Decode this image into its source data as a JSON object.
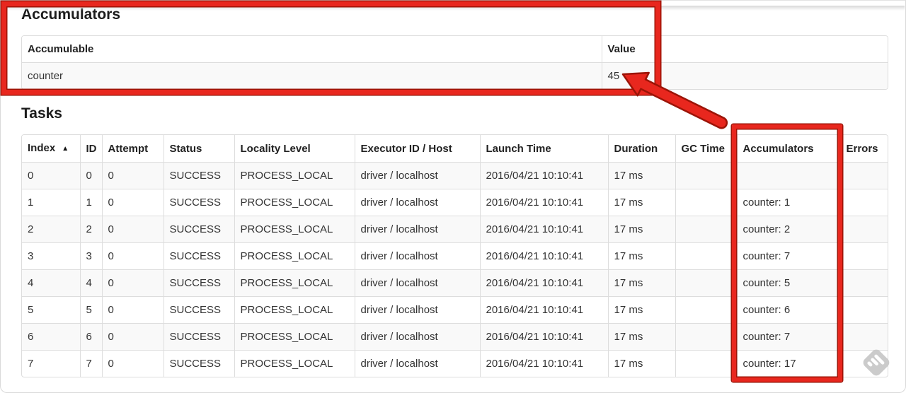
{
  "accumulators_section": {
    "title": "Accumulators",
    "table": {
      "headers": [
        "Accumulable",
        "Value"
      ],
      "rows": [
        {
          "accumulable": "counter",
          "value": "45"
        }
      ]
    }
  },
  "tasks_section": {
    "title": "Tasks",
    "table": {
      "headers": {
        "index": "Index",
        "id": "ID",
        "attempt": "Attempt",
        "status": "Status",
        "locality": "Locality Level",
        "executor": "Executor ID / Host",
        "launch": "Launch Time",
        "duration": "Duration",
        "gc": "GC Time",
        "accumulators": "Accumulators",
        "errors": "Errors"
      },
      "sort_indicator": "▲",
      "rows": [
        {
          "index": "0",
          "id": "0",
          "attempt": "0",
          "status": "SUCCESS",
          "locality": "PROCESS_LOCAL",
          "executor": "driver / localhost",
          "launch": "2016/04/21 10:10:41",
          "duration": "17 ms",
          "gc": "",
          "accumulators": "",
          "errors": ""
        },
        {
          "index": "1",
          "id": "1",
          "attempt": "0",
          "status": "SUCCESS",
          "locality": "PROCESS_LOCAL",
          "executor": "driver / localhost",
          "launch": "2016/04/21 10:10:41",
          "duration": "17 ms",
          "gc": "",
          "accumulators": "counter: 1",
          "errors": ""
        },
        {
          "index": "2",
          "id": "2",
          "attempt": "0",
          "status": "SUCCESS",
          "locality": "PROCESS_LOCAL",
          "executor": "driver / localhost",
          "launch": "2016/04/21 10:10:41",
          "duration": "17 ms",
          "gc": "",
          "accumulators": "counter: 2",
          "errors": ""
        },
        {
          "index": "3",
          "id": "3",
          "attempt": "0",
          "status": "SUCCESS",
          "locality": "PROCESS_LOCAL",
          "executor": "driver / localhost",
          "launch": "2016/04/21 10:10:41",
          "duration": "17 ms",
          "gc": "",
          "accumulators": "counter: 7",
          "errors": ""
        },
        {
          "index": "4",
          "id": "4",
          "attempt": "0",
          "status": "SUCCESS",
          "locality": "PROCESS_LOCAL",
          "executor": "driver / localhost",
          "launch": "2016/04/21 10:10:41",
          "duration": "17 ms",
          "gc": "",
          "accumulators": "counter: 5",
          "errors": ""
        },
        {
          "index": "5",
          "id": "5",
          "attempt": "0",
          "status": "SUCCESS",
          "locality": "PROCESS_LOCAL",
          "executor": "driver / localhost",
          "launch": "2016/04/21 10:10:41",
          "duration": "17 ms",
          "gc": "",
          "accumulators": "counter: 6",
          "errors": ""
        },
        {
          "index": "6",
          "id": "6",
          "attempt": "0",
          "status": "SUCCESS",
          "locality": "PROCESS_LOCAL",
          "executor": "driver / localhost",
          "launch": "2016/04/21 10:10:41",
          "duration": "17 ms",
          "gc": "",
          "accumulators": "counter: 7",
          "errors": ""
        },
        {
          "index": "7",
          "id": "7",
          "attempt": "0",
          "status": "SUCCESS",
          "locality": "PROCESS_LOCAL",
          "executor": "driver / localhost",
          "launch": "2016/04/21 10:10:41",
          "duration": "17 ms",
          "gc": "",
          "accumulators": "counter: 17",
          "errors": ""
        }
      ]
    }
  },
  "annotations": {
    "accent_red": "#e8271e",
    "accent_red_dark": "#9c1407",
    "highlighted_value": "45",
    "highlighted_column": "Accumulators"
  },
  "icons": {
    "sort_ascending": "sort-ascending-icon",
    "watermark": "feedly-diamond-icon"
  }
}
